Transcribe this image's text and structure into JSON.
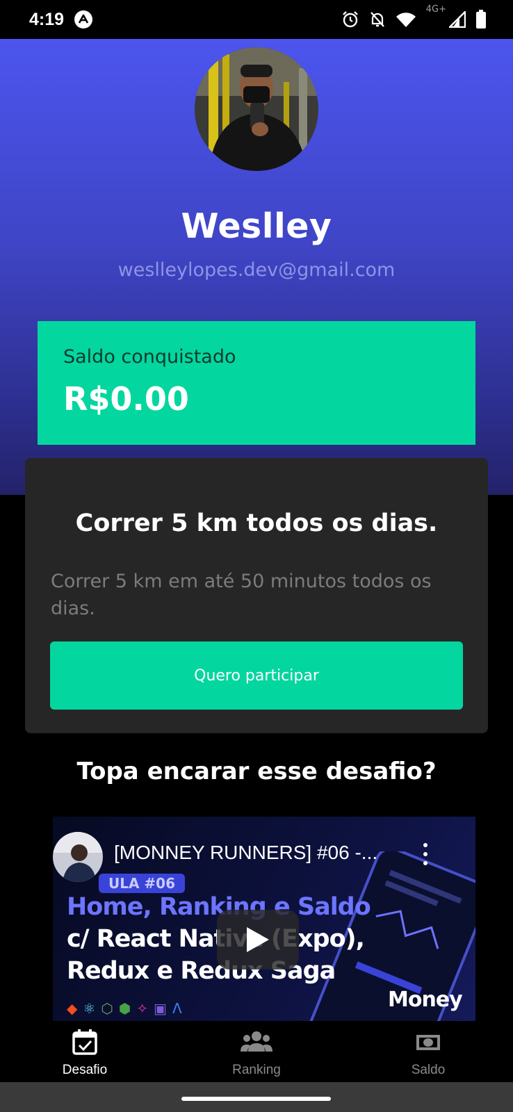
{
  "status_bar": {
    "time": "4:19",
    "network": "4G+",
    "icons": [
      "app-logo-icon",
      "alarm-icon",
      "notifications-off-icon",
      "wifi-icon",
      "signal-icon",
      "battery-icon"
    ]
  },
  "profile": {
    "name": "Weslley",
    "email": "weslleylopes.dev@gmail.com"
  },
  "balance": {
    "label": "Saldo conquistado",
    "value": "R$0.00"
  },
  "challenge": {
    "title": "Correr 5 km todos os dias.",
    "description": "Correr 5 km em até 50 minutos todos os dias.",
    "button_label": "Quero participar"
  },
  "prompt": "Topa encarar esse desafio?",
  "video": {
    "title": "[MONNEY RUNNERS] #06 -...",
    "tag": "ULA #06",
    "headline_1": "Home, Ranking e Saldo",
    "headline_2": "c/ React Native (Expo),",
    "headline_3": "Redux e Redux Saga",
    "brand": "Money"
  },
  "tabs": [
    {
      "label": "Desafio",
      "icon": "calendar-check-icon",
      "active": true
    },
    {
      "label": "Ranking",
      "icon": "people-icon",
      "active": false
    },
    {
      "label": "Saldo",
      "icon": "money-icon",
      "active": false
    }
  ],
  "colors": {
    "accent": "#04d69f",
    "hero_top": "#4c55ee",
    "hero_bottom": "#23226a",
    "card": "#262626"
  }
}
